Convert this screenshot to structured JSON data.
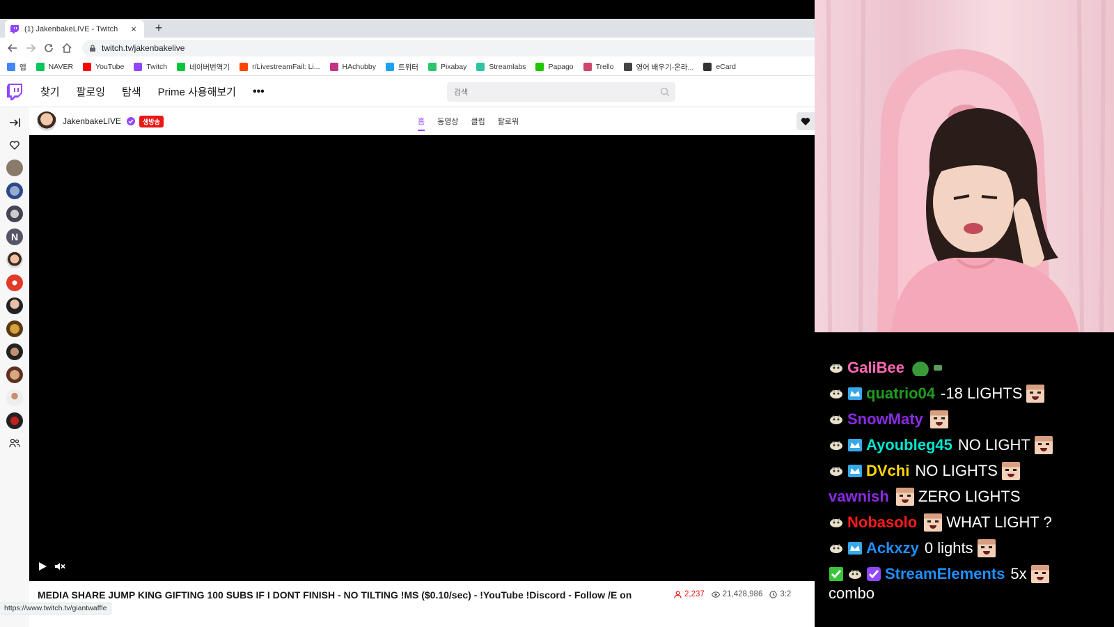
{
  "browser": {
    "tab_title": "(1) JakenbakeLIVE - Twitch",
    "tab_close": "×",
    "new_tab": "+",
    "url": "twitch.tv/jakenbakelive",
    "status_url": "https://www.twitch.tv/giantwaffle",
    "bookmarks": [
      {
        "label": "앱",
        "color": "#4285f4"
      },
      {
        "label": "NAVER",
        "color": "#03c75a"
      },
      {
        "label": "YouTube",
        "color": "#ff0000"
      },
      {
        "label": "Twitch",
        "color": "#9147ff"
      },
      {
        "label": "네이버번역기",
        "color": "#00c73c"
      },
      {
        "label": "r/LivestreamFail: Li...",
        "color": "#ff4500"
      },
      {
        "label": "HAchubby",
        "color": "#c13584"
      },
      {
        "label": "트위터",
        "color": "#1da1f2"
      },
      {
        "label": "Pixabay",
        "color": "#2ec66d"
      },
      {
        "label": "Streamlabs",
        "color": "#31c3a2"
      },
      {
        "label": "Papago",
        "color": "#1ec800"
      },
      {
        "label": "Trello",
        "color": "#d0466a"
      },
      {
        "label": "영어 배우기-온라...",
        "color": "#444444"
      },
      {
        "label": "eCard",
        "color": "#333333"
      }
    ]
  },
  "twitch_nav": {
    "links": [
      "찾기",
      "팔로잉",
      "탐색",
      "Prime 사용해보기"
    ],
    "more": "•••",
    "search_placeholder": "검색"
  },
  "channel": {
    "name": "JakenbakeLIVE",
    "live_badge": "생방송",
    "tabs": [
      "홈",
      "동영상",
      "클립",
      "팔로워"
    ],
    "stream_title": "MEDIA SHARE JUMP KING GIFTING 100 SUBS IF I DONT FINISH - NO TILTING !MS ($0.10/sec) - !YouTube !Discord - Follow /E on !Socials",
    "viewers": "2,237",
    "total_views": "21,428,986",
    "uptime": "3:2"
  },
  "chat": [
    {
      "user": "GaliBee",
      "color": "#ff69b4",
      "badges": [
        "mod"
      ],
      "text": ""
    },
    {
      "user": "quatrio04",
      "color": "#1e9e1e",
      "badges": [
        "mod",
        "sub"
      ],
      "text": "-18 LIGHTS"
    },
    {
      "user": "SnowMaty",
      "color": "#8a2be2",
      "badges": [
        "mod"
      ],
      "text": ""
    },
    {
      "user": "Ayoubleg45",
      "color": "#00e5d0",
      "badges": [
        "mod",
        "sub"
      ],
      "text": "NO LIGHT"
    },
    {
      "user": "DVchi",
      "color": "#ffd700",
      "badges": [
        "mod",
        "sub"
      ],
      "text": "NO LIGHTS"
    },
    {
      "user": "vawnish",
      "color": "#8a2be2",
      "badges": [],
      "text": "ZERO LIGHTS"
    },
    {
      "user": "Nobasolo",
      "color": "#ff1a1a",
      "badges": [
        "mod"
      ],
      "text": "WHAT LIGHT ?"
    },
    {
      "user": "Ackxzy",
      "color": "#1e90ff",
      "badges": [
        "mod",
        "sub"
      ],
      "text": "0 lights"
    },
    {
      "user": "StreamElements",
      "color": "#1e90ff",
      "badges": [
        "check",
        "mod",
        "verified"
      ],
      "text": "5x",
      "text2": "combo"
    }
  ]
}
